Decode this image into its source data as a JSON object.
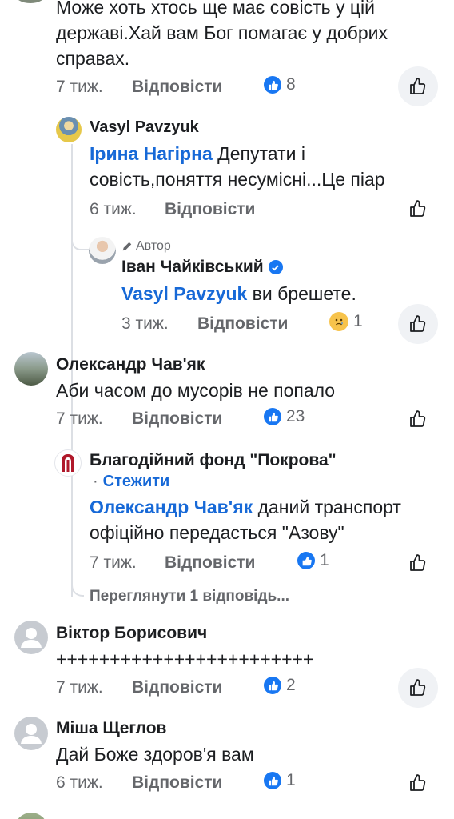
{
  "comments": {
    "c1": {
      "text": "Може хоть хтось ще має совість у цій державі.Хай вам Бог помагає у добрих справах.",
      "time": "7 тиж.",
      "reply": "Відповісти",
      "reactions": "8"
    },
    "c2": {
      "name": "Vasyl Pavzyuk",
      "mention": "Ірина Нагірна",
      "text": " Депутати і совість,поняття несумісні...Це піар",
      "time": "6 тиж.",
      "reply": "Відповісти"
    },
    "c3": {
      "badge": "Автор",
      "name": "Іван Чайківський",
      "mention": "Vasyl Pavzyuk",
      "text": " ви брешете.",
      "time": "3 тиж.",
      "reply": "Відповісти",
      "reactions": "1"
    },
    "c4": {
      "name": "Олександр Чав'як",
      "text": "Аби часом до мусорів не попало",
      "time": "7 тиж.",
      "reply": "Відповісти",
      "reactions": "23"
    },
    "c5": {
      "name": "Благодійний фонд \"Покрова\"",
      "follow_sep": "·",
      "follow": "Стежити",
      "mention": "Олександр Чав'як",
      "text": " даний транспорт офіційно передасться \"Азову\"",
      "time": "7 тиж.",
      "reply": "Відповісти",
      "reactions": "1",
      "view_replies": "Переглянути 1 відповідь..."
    },
    "c6": {
      "name": "Віктор Борисович",
      "text": "++++++++++++++++++++++++",
      "time": "7 тиж.",
      "reply": "Відповісти",
      "reactions": "2"
    },
    "c7": {
      "name": "Міша Щеглов",
      "text": "Дай Боже здоров'я вам",
      "time": "6 тиж.",
      "reply": "Відповісти",
      "reactions": "1"
    }
  },
  "colors": {
    "link": "#1769d7",
    "like_blue": "#1877f2",
    "secondary": "#65676b",
    "thread": "#dcdfe4"
  }
}
